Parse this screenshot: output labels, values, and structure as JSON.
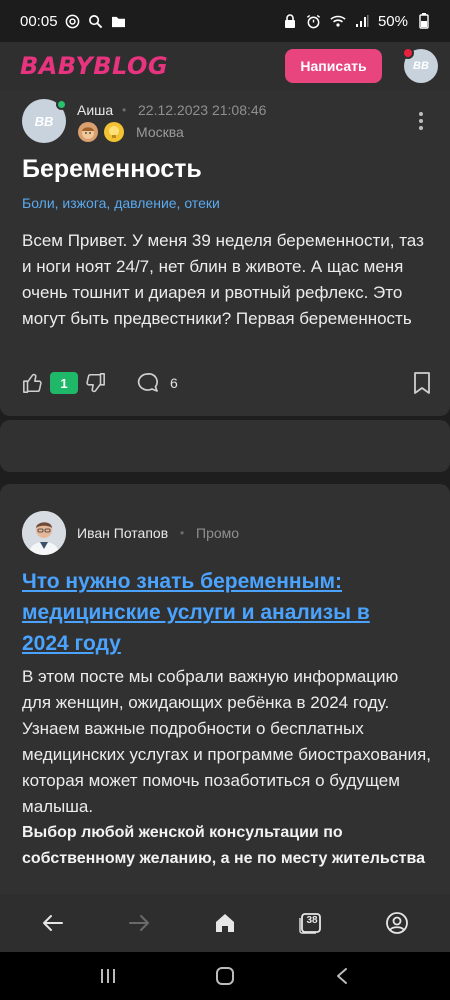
{
  "status_bar": {
    "time": "00:05",
    "battery": "50%"
  },
  "header": {
    "logo": "BABYBLOG",
    "write_button": "Написать",
    "avatar_initials": "BB"
  },
  "post": {
    "author": "Аиша",
    "date": "22.12.2023 21:08:46",
    "city": "Москва",
    "avatar_initials": "BB",
    "title": "Беременность",
    "tags": "Боли, изжога, давление, отеки",
    "body": "Всем Привет. У меня 39 неделя беременности, таз и ноги ноят 24/7, нет блин в животе. А щас меня очень тошнит и диарея и рвотный рефлекс. Это могут быть предвестники? Первая беременность",
    "likes": "1",
    "comments": "6"
  },
  "promo_post": {
    "author": "Иван Потапов",
    "label": "Промо",
    "title": "Что нужно знать беременным: медицинские услуги и анализы в 2024 году",
    "body": "В этом посте мы собрали важную информацию для женщин, ожидающих ребёнка в 2024 году. Узнаем важные подробности о бесплатных медицинских услугах и программе биострахования, которая может помочь позаботиться о будущем малыша.",
    "bold_text": "Выбор любой женской консультации по собственному желанию, а не по месту жительства"
  },
  "browser_nav": {
    "tabs_count": "38"
  },
  "colors": {
    "brand": "#e8347f",
    "link": "#4aa4ff",
    "like_badge": "#1fb868"
  }
}
